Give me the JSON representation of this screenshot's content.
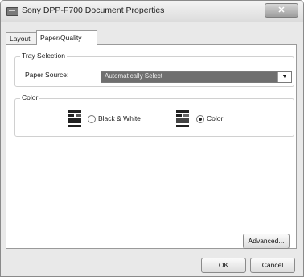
{
  "window": {
    "title": "Sony DPP-F700 Document Properties",
    "close_glyph": "✕"
  },
  "tabs": [
    {
      "label": "Layout"
    },
    {
      "label": "Paper/Quality"
    }
  ],
  "tray_selection": {
    "group_label": "Tray Selection",
    "paper_source_label": "Paper Source:",
    "paper_source_value": "Automatically Select"
  },
  "color": {
    "group_label": "Color",
    "options": [
      {
        "label": "Black & White",
        "selected": false
      },
      {
        "label": "Color",
        "selected": true
      }
    ]
  },
  "buttons": {
    "advanced": "Advanced...",
    "ok": "OK",
    "cancel": "Cancel"
  }
}
